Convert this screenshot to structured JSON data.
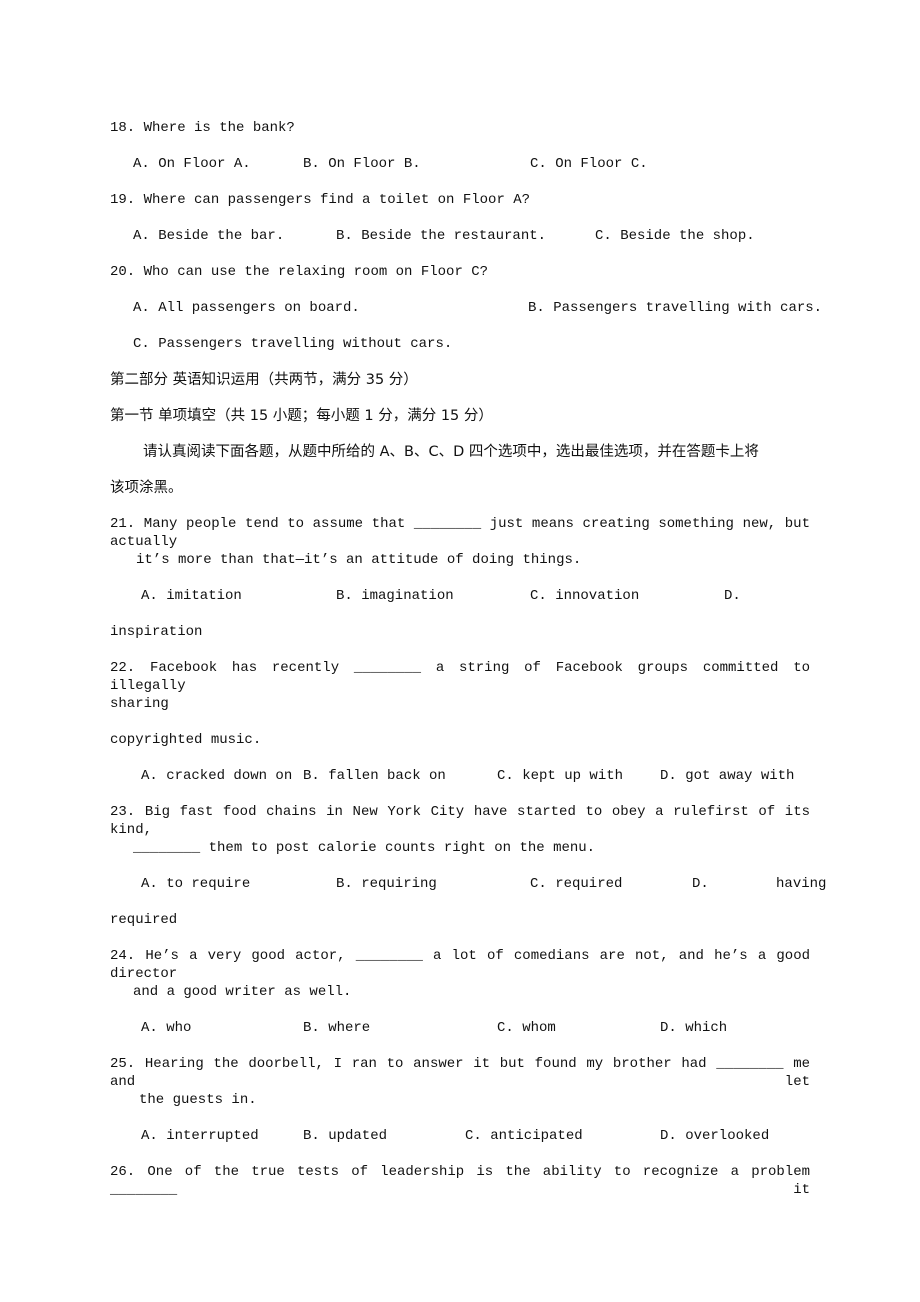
{
  "q18": {
    "stem": "18. Where is the bank?",
    "a": "A. On Floor A.",
    "b": "B. On Floor B.",
    "c": "C. On Floor C."
  },
  "q19": {
    "stem": "19. Where can passengers find a toilet on Floor A?",
    "a": "A. Beside the bar.",
    "b": "B. Beside the restaurant.",
    "c": "C. Beside the shop."
  },
  "q20": {
    "stem": "20. Who can use the relaxing room on Floor C?",
    "a": "A. All passengers on board.",
    "b": "B. Passengers travelling with cars.",
    "c": "C. Passengers travelling without cars."
  },
  "section": {
    "part2": "第二部分 英语知识运用（共两节，满分 35 分）",
    "sec1": "第一节 单项填空（共 15 小题；每小题 1 分，满分 15 分）",
    "instr1": "请认真阅读下面各题，从题中所给的 A、B、C、D 四个选项中，选出最佳选项，并在答题卡上将",
    "instr2": "该项涂黑。"
  },
  "q21": {
    "stem1": "21. Many people tend to assume that ________ just means creating something new, but actually",
    "stem2": "it’s more than that—it’s an attitude of doing things.",
    "a": "A. imitation",
    "b": "B. imagination",
    "c": "C. innovation",
    "d": "D.",
    "d2": "inspiration"
  },
  "q22": {
    "stem1": "22. Facebook has recently ________ a string of Facebook groups committed to illegally",
    "stem2": "sharing",
    "stem3": "copyrighted music.",
    "a": "A. cracked down on",
    "b": "B. fallen back on",
    "c": "C. kept up with",
    "d": "D. got away with"
  },
  "q23": {
    "stem1": "23. Big fast food chains in New York City have started to obey a rulefirst of its kind,",
    "stem2": "________ them to post calorie counts right on the menu.",
    "a": "A. to require",
    "b": "B. requiring",
    "c": "C. required",
    "d": "D.        having",
    "d2": "required"
  },
  "q24": {
    "stem1": "24. He’s a very good actor, ________ a lot of comedians are not, and he’s a good director",
    "stem2": "and a good writer as well.",
    "a": "A. who",
    "b": "B. where",
    "c": "C. whom",
    "d": "D. which"
  },
  "q25": {
    "stem1": "25. Hearing the doorbell, I ran to answer it but found my brother had ________ me and let",
    "stem2": "the guests in.",
    "a": "A. interrupted",
    "b": "B. updated",
    "c": "C. anticipated",
    "d": "D. overlooked"
  },
  "q26": {
    "stem1": "26. One of the true tests of leadership is the ability to recognize a problem ________ it"
  }
}
